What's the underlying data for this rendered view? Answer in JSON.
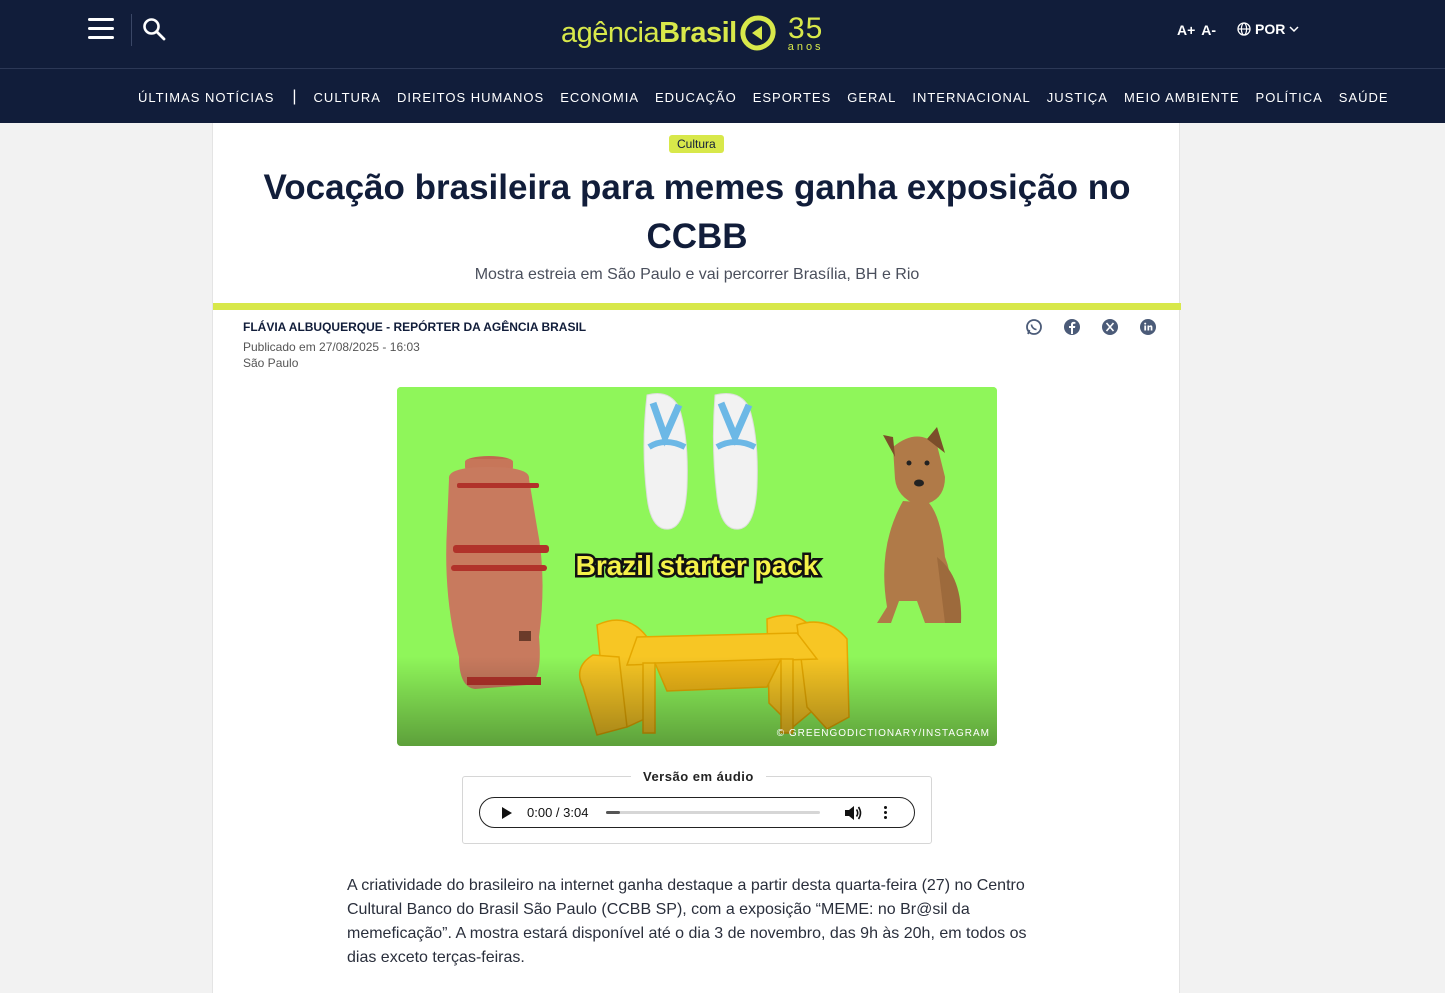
{
  "header": {
    "logo_light": "agência",
    "logo_bold": "Brasil",
    "logo_years": "35",
    "logo_years_label": "anos",
    "font_increase": "A+",
    "font_decrease": "A-",
    "language": "POR"
  },
  "nav": {
    "primary": "ÚLTIMAS NOTÍCIAS",
    "separator": "|",
    "items": [
      "CULTURA",
      "DIREITOS HUMANOS",
      "ECONOMIA",
      "EDUCAÇÃO",
      "ESPORTES",
      "GERAL",
      "INTERNACIONAL",
      "JUSTIÇA",
      "MEIO AMBIENTE",
      "POLÍTICA",
      "SAÚDE"
    ]
  },
  "article": {
    "tag": "Cultura",
    "headline": "Vocação brasileira para memes ganha exposição no CCBB",
    "subheadline": "Mostra estreia em São Paulo e vai percorrer Brasília, BH e Rio",
    "byline": "FLÁVIA ALBUQUERQUE - REPÓRTER DA AGÊNCIA BRASIL",
    "published": "Publicado em 27/08/2025 - 16:03",
    "location": "São Paulo",
    "image_caption_text": "Brazil starter pack",
    "image_credit": "© GREENGODICTIONARY/INSTAGRAM",
    "audio_label": "Versão em áudio",
    "audio_time": "0:00 / 3:04",
    "audio_progress_fraction": 0.0,
    "body": "A criatividade do brasileiro na internet ganha destaque a partir desta quarta-feira (27) no Centro Cultural Banco do Brasil São Paulo (CCBB SP), com a exposição “MEME: no Br@sil da memeficação”. A mostra estará disponível até o dia 3 de novembro, das 9h às 20h, em todos os dias exceto terças-feiras."
  },
  "colors": {
    "navy": "#111d3a",
    "accent_yellow": "#d8e84a",
    "image_green": "#8ff65a"
  },
  "share_icons": [
    "whatsapp-icon",
    "facebook-icon",
    "x-icon",
    "linkedin-icon"
  ]
}
